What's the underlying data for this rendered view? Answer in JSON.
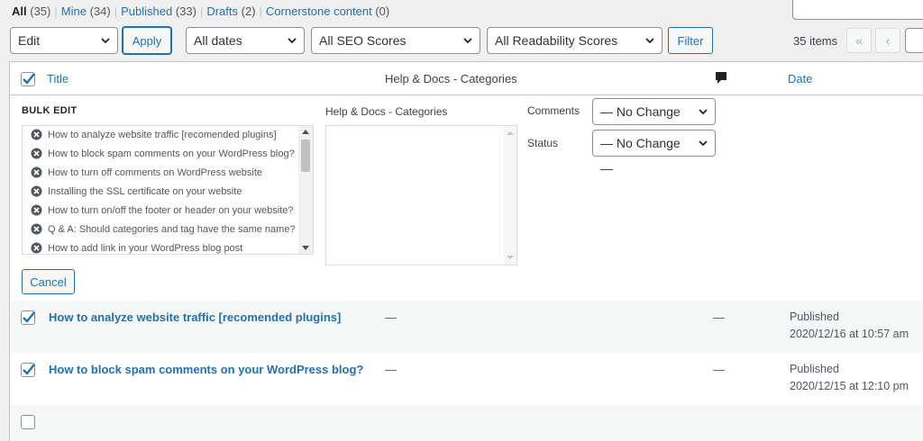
{
  "views": {
    "all": {
      "label": "All",
      "count": "(35)"
    },
    "mine": {
      "label": "Mine",
      "count": "(34)"
    },
    "published": {
      "label": "Published",
      "count": "(33)"
    },
    "drafts": {
      "label": "Drafts",
      "count": "(2)"
    },
    "cornerstone": {
      "label": "Cornerstone content",
      "count": "(0)"
    },
    "separator": "|"
  },
  "tablenav": {
    "bulk_action": "Edit",
    "apply_label": "Apply",
    "date_filter": "All dates",
    "seo_filter": "All SEO Scores",
    "readability_filter": "All Readability Scores",
    "filter_label": "Filter",
    "items_count": "35 items",
    "first_page": "«",
    "prev_page": "‹"
  },
  "columns": {
    "title": "Title",
    "categories": "Help & Docs - Categories",
    "date": "Date"
  },
  "bulk_edit": {
    "heading": "BULK EDIT",
    "posts": [
      "How to analyze website traffic [recomended plugins]",
      "How to block spam comments on your WordPress blog?",
      "How to turn off comments on WordPress website",
      "Installing the SSL certificate on your website",
      "How to turn on/off the footer or header on your website?",
      "Q & A: Should categories and tag have the same name?",
      "How to add link in your WordPress blog post"
    ],
    "categories_label": "Help & Docs - Categories",
    "comments_label": "Comments",
    "comments_value": "— No Change —",
    "status_label": "Status",
    "status_value": "— No Change —",
    "cancel_label": "Cancel"
  },
  "rows": [
    {
      "title": "How to analyze website traffic [recomended plugins]",
      "categories": "—",
      "comments": "—",
      "status": "Published",
      "date": "2020/12/16 at 10:57 am"
    },
    {
      "title": "How to block spam comments on your WordPress blog?",
      "categories": "—",
      "comments": "—",
      "status": "Published",
      "date": "2020/12/15 at 12:10 pm"
    }
  ],
  "colors": {
    "link": "#2271b1",
    "border": "#c3c4c7",
    "background": "#f0f0f1"
  }
}
